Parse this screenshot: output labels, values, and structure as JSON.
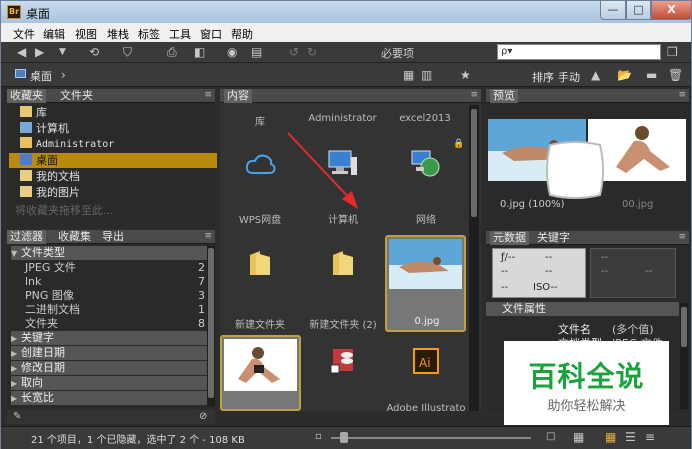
{
  "window": {
    "title": "桌面",
    "app_icon_text": "Br",
    "close_glyph": "X"
  },
  "menu": [
    "文件",
    "编辑",
    "视图",
    "堆栈",
    "标签",
    "工具",
    "窗口",
    "帮助"
  ],
  "toolbar": {
    "workspace": "必要项",
    "search_placeholder": "ρ▾"
  },
  "pathbar": {
    "breadcrumb": "桌面",
    "sort_label": "排序",
    "sort_mode": "手动"
  },
  "left": {
    "fav_tabs": [
      "收藏夹",
      "文件夹"
    ],
    "favorites": [
      "库",
      "计算机",
      "Administrator",
      "桌面",
      "我的文档",
      "我的图片"
    ],
    "fav_hint": "将收藏夹拖移至此...",
    "filter_tabs": [
      "过滤器",
      "收藏集",
      "导出"
    ],
    "filters": [
      {
        "type": "category",
        "label": "文件类型",
        "open": true
      },
      {
        "type": "item",
        "label": "JPEG 文件",
        "count": "2"
      },
      {
        "type": "item",
        "label": "lnk",
        "count": "7"
      },
      {
        "type": "item",
        "label": "PNG 图像",
        "count": "3"
      },
      {
        "type": "item",
        "label": "二进制文档",
        "count": "1"
      },
      {
        "type": "item",
        "label": "文件夹",
        "count": "8"
      },
      {
        "type": "category",
        "label": "关键字",
        "open": false
      },
      {
        "type": "category",
        "label": "创建日期",
        "open": false
      },
      {
        "type": "category",
        "label": "修改日期",
        "open": false
      },
      {
        "type": "category",
        "label": "取向",
        "open": false
      },
      {
        "type": "category",
        "label": "长宽比",
        "open": false
      }
    ]
  },
  "content": {
    "tab": "内容",
    "top_labels": [
      "库",
      "Administrator",
      "excel2013"
    ],
    "items": [
      {
        "label": "WPS网盘",
        "icon": "cloud-icon"
      },
      {
        "label": "计算机",
        "icon": "computer-icon"
      },
      {
        "label": "网络",
        "icon": "network-icon"
      },
      {
        "label": "新建文件夹",
        "icon": "folder-icon"
      },
      {
        "label": "新建文件夹 (2)",
        "icon": "folder-icon"
      },
      {
        "label": "0.jpg",
        "icon": "photo-thumbnail",
        "selected": true
      },
      {
        "label": "",
        "icon": "photo-thumbnail"
      },
      {
        "label": "",
        "icon": "access-icon"
      },
      {
        "label": "Adobe Illustrato",
        "icon": "illustrator-icon"
      }
    ]
  },
  "preview": {
    "tab": "预览",
    "captions": [
      "0.jpg (100%)",
      "00.jpg"
    ]
  },
  "metadata": {
    "tabs": [
      "元数据",
      "关键字"
    ],
    "camera": {
      "f": "ƒ/--",
      "a": "--",
      "b": "--",
      "c": "--",
      "d": "--",
      "e": "--",
      "iso": "ISO--"
    },
    "section": "文件属性",
    "rows": [
      {
        "k": "文件名",
        "v": "(多个值)"
      },
      {
        "k": "文档类型",
        "v": "JPEG 文件"
      }
    ]
  },
  "status": {
    "text": "21 个项目，1 个已隐藏，选中了 2 个 - 108 KB"
  },
  "watermark": {
    "title": "百科全说",
    "subtitle": "助你轻松解决"
  },
  "colors": {
    "selection": "#b88a0a",
    "accent_border": "#c0a040"
  }
}
